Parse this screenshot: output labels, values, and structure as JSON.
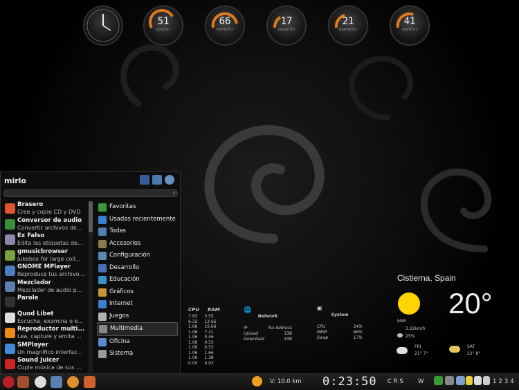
{
  "gauges": [
    {
      "value": "51",
      "label": "cpu(%)"
    },
    {
      "value": "66",
      "label": "mem(%)"
    },
    {
      "value": "17",
      "label": "swap(%)"
    },
    {
      "value": "21",
      "label": "home(%)"
    },
    {
      "value": "41",
      "label": "root(%)"
    }
  ],
  "menu": {
    "user": "mirlo",
    "apps": [
      {
        "name": "Brasero",
        "desc": "Cree y copie CD y DVD",
        "color": "#e0542e"
      },
      {
        "name": "Conversor de audio",
        "desc": "Convertir archivos de...",
        "color": "#3a8f3a"
      },
      {
        "name": "Ex Falso",
        "desc": "Edita las etiquetas de...",
        "color": "#8888aa"
      },
      {
        "name": "gmusicbrowser",
        "desc": "Jukebox for large coll...",
        "color": "#7aa13b"
      },
      {
        "name": "GNOME MPlayer",
        "desc": "Reproduce tus archivo...",
        "color": "#4a7fc0"
      },
      {
        "name": "Mezclador",
        "desc": "Mezclador de audio p...",
        "color": "#5a7fb0"
      },
      {
        "name": "Parole",
        "desc": "",
        "color": "#333333"
      },
      {
        "name": "Quod Libet",
        "desc": "Escucha, examina o e...",
        "color": "#dddddd"
      },
      {
        "name": "Reproductor multi...",
        "desc": "Lea, capture y emita ...",
        "color": "#f08a16"
      },
      {
        "name": "SMPlayer",
        "desc": "Un magnífico interfaz...",
        "color": "#3f8ad8"
      },
      {
        "name": "Sound Juicer",
        "desc": "Copie música de sus ...",
        "color": "#cc2222"
      }
    ],
    "categories": [
      {
        "label": "Favoritas",
        "color": "#3a9a3a"
      },
      {
        "label": "Usadas recientemente",
        "color": "#3a7fd0"
      },
      {
        "label": "Todas",
        "color": "#5080b0"
      },
      {
        "label": "Accesorios",
        "color": "#8a7a50"
      },
      {
        "label": "Configuración",
        "color": "#5a8ab0"
      },
      {
        "label": "Desarrollo",
        "color": "#4a70b0"
      },
      {
        "label": "Educación",
        "color": "#3a90c8"
      },
      {
        "label": "Gráficos",
        "color": "#c8963a"
      },
      {
        "label": "Internet",
        "color": "#3a7fd0"
      },
      {
        "label": "Juegos",
        "color": "#b0b0b0"
      },
      {
        "label": "Multimedia",
        "color": "#888888"
      },
      {
        "label": "Oficina",
        "color": "#5a8ad0"
      },
      {
        "label": "Sistema",
        "color": "#999999"
      }
    ]
  },
  "conky_procs": {
    "header_cpu": "CPU",
    "header_ram": "RAM",
    "cpu": [
      "7.93",
      "6.32",
      "1.06",
      "1.06",
      "1.06",
      "1.06",
      "1.06",
      "1.06",
      "1.06",
      "0.00"
    ],
    "ram": [
      "3.55",
      "12.66",
      "10.66",
      "7.21",
      "0.46",
      "0.53",
      "0.53",
      "1.66",
      "1.38",
      "0.03"
    ]
  },
  "conky_network": {
    "title": "Network",
    "ip_label": "IP",
    "ip_value": "No Address",
    "up_label": "Upload",
    "up_value": "33B",
    "down_label": "Download",
    "down_value": "33B"
  },
  "conky_system": {
    "title": "System",
    "cpu_label": "CPU",
    "cpu_value": "34%",
    "mem_label": "MEM",
    "mem_value": "66%",
    "swap_label": "Swap",
    "swap_value": "17%"
  },
  "weather": {
    "location": "Cistierna, Spain",
    "temp": "20°",
    "condition": "FAIR",
    "wind": "3.22km/h",
    "humidity": "25%",
    "fri_label": "FRI",
    "fri_range": "21° 7°",
    "sat_label": "SAT",
    "sat_range": "22° 8°"
  },
  "taskbar": {
    "weather_text": "V: 10.0 km",
    "clock": "0:23:50",
    "tray_letters": "C R S",
    "tray_w": "W",
    "workspaces": [
      "1",
      "2",
      "3",
      "4"
    ]
  }
}
